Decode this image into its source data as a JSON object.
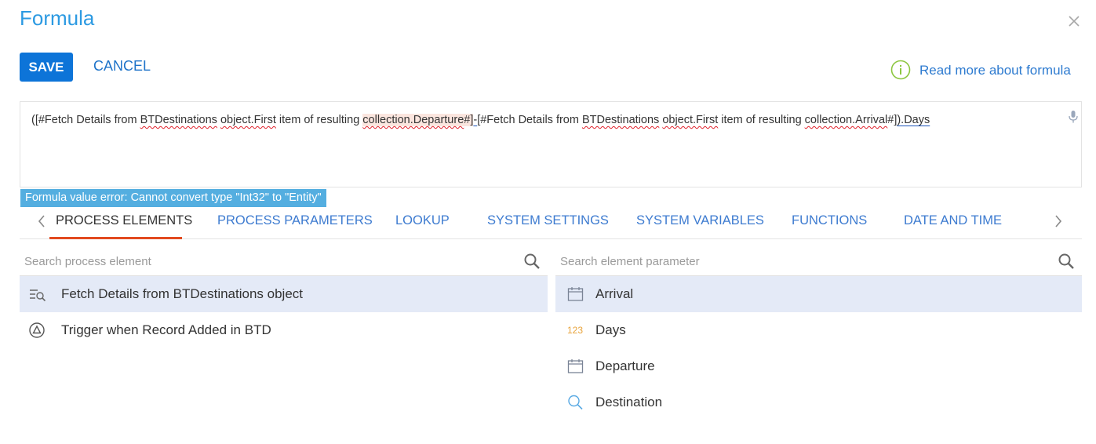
{
  "header": {
    "title": "Formula",
    "save_label": "SAVE",
    "cancel_label": "CANCEL",
    "read_more_label": "Read more about formula"
  },
  "formula": {
    "p1": "([#Fetch Details from ",
    "p2": "BTDestinations",
    "p3": " ",
    "p4": "object.First",
    "p5": " item of resulting ",
    "p6": "collection.Departure",
    "p7": "#]",
    "p8": "-",
    "p9": "[#Fetch Details from ",
    "p10": "BTDestinations",
    "p11": " ",
    "p12": "object.First",
    "p13": " item of resulting ",
    "p14": "collection.Arrival",
    "p15": "#]",
    "p16": ").Days"
  },
  "error": {
    "message": "Formula value error: Cannot convert type \"Int32\" to \"Entity\""
  },
  "tabs": [
    {
      "label": "PROCESS ELEMENTS",
      "active": true
    },
    {
      "label": "PROCESS PARAMETERS"
    },
    {
      "label": "LOOKUP"
    },
    {
      "label": "SYSTEM SETTINGS"
    },
    {
      "label": "SYSTEM VARIABLES"
    },
    {
      "label": "FUNCTIONS"
    },
    {
      "label": "DATE AND TIME"
    }
  ],
  "left_panel": {
    "search_placeholder": "Search process element",
    "items": [
      {
        "label": "Fetch Details from BTDestinations object",
        "icon": "read-data-icon",
        "selected": true
      },
      {
        "label": "Trigger when Record Added in BTD",
        "icon": "start-signal-icon"
      }
    ]
  },
  "right_panel": {
    "search_placeholder": "Search element parameter",
    "items": [
      {
        "label": "Arrival",
        "icon": "calendar-icon",
        "selected": true
      },
      {
        "label": "Days",
        "icon": "number-icon",
        "icon_text": "123"
      },
      {
        "label": "Departure",
        "icon": "calendar-icon"
      },
      {
        "label": "Destination",
        "icon": "lookup-icon"
      }
    ]
  },
  "colors": {
    "accent": "#0d74d8",
    "title": "#2c9ae2",
    "link": "#2e7bd0",
    "error_bg": "#54aee0",
    "active_tab_underline": "#e24a1f",
    "selected_row": "#e4eaf7"
  }
}
